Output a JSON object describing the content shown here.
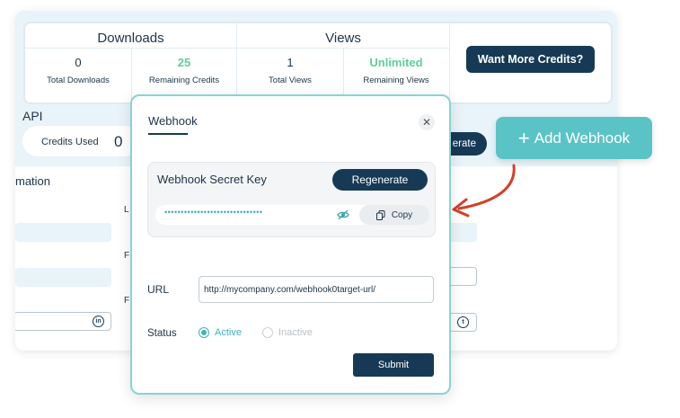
{
  "stats": {
    "downloads_title": "Downloads",
    "views_title": "Views",
    "total_downloads": "0",
    "total_downloads_label": "Total Downloads",
    "remaining_credits": "25",
    "remaining_credits_label": "Remaining Credits",
    "total_views": "1",
    "total_views_label": "Total Views",
    "remaining_views": "Unlimited",
    "remaining_views_label": "Remaining Views",
    "more_credits_button": "Want More Credits?"
  },
  "api": {
    "title": "API",
    "credits_used_label": "Credits Used",
    "credits_used_value": "0",
    "generate_button_partial": "erate"
  },
  "information": {
    "title_partial": "mation",
    "label_l": "L",
    "label_f1": "F",
    "label_f2": "F"
  },
  "add_webhook_button": "Add Webhook",
  "modal": {
    "title": "Webhook",
    "close_icon": "close-icon",
    "secret": {
      "title": "Webhook Secret Key",
      "regenerate_button": "Regenerate",
      "masked_key": "••••••••••••••••••••••••••••••",
      "copy_button": "Copy"
    },
    "url_label": "URL",
    "url_value": "http://mycompany.com/webhook0target-url/",
    "status_label": "Status",
    "status_options": [
      "Active",
      "Inactive"
    ],
    "status_selected": "Active",
    "submit_button": "Submit"
  },
  "colors": {
    "navy": "#163a55",
    "teal": "#5ac3c6",
    "green": "#5fcf98",
    "arrow_red": "#d4402b"
  }
}
